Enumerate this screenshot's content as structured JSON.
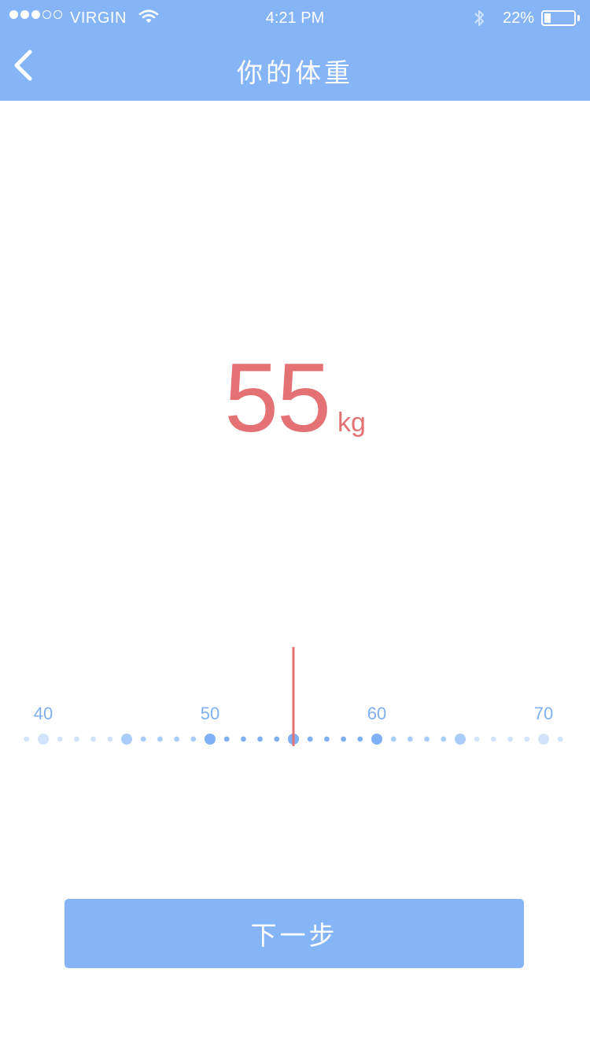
{
  "status_bar": {
    "carrier": "VIRGIN",
    "time": "4:21 PM",
    "battery_percent": "22%",
    "battery_level": 0.22,
    "signal_strength": 3,
    "signal_max": 5,
    "icons": [
      "wifi-icon",
      "bluetooth-icon",
      "battery-icon"
    ]
  },
  "nav": {
    "title": "你的体重",
    "back_icon": "chevron-left-icon"
  },
  "weight": {
    "value": "55",
    "unit": "kg"
  },
  "ruler": {
    "min": 40,
    "max": 70,
    "selected": 55,
    "labels": [
      "40",
      "50",
      "60",
      "70"
    ]
  },
  "next_button": {
    "label": "下一步"
  },
  "colors": {
    "primary": "#86b5f7",
    "accent": "#e47274",
    "tick_label": "#7fb0f5",
    "white": "#ffffff"
  }
}
